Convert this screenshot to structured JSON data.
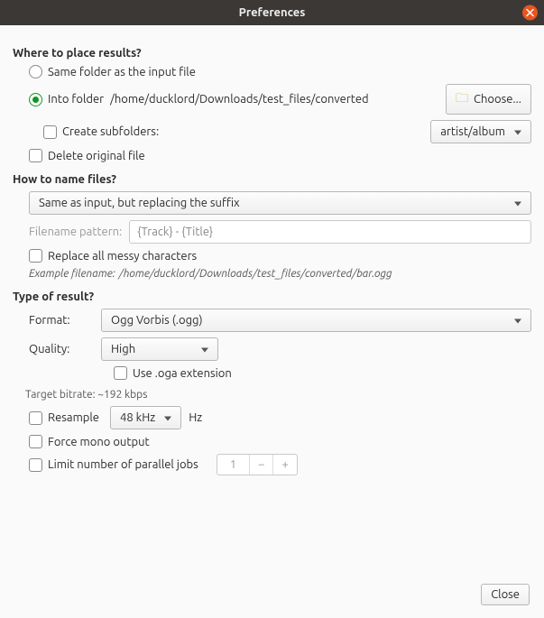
{
  "window": {
    "title": "Preferences"
  },
  "section1": {
    "heading": "Where to place results?",
    "radio_same": "Same folder as the input file",
    "radio_into": "Into folder",
    "into_path": "/home/ducklord/Downloads/test_files/converted",
    "choose_btn": "Choose...",
    "create_subfolders": "Create subfolders:",
    "subfolder_scheme": "artist/album",
    "delete_original": "Delete original file"
  },
  "section2": {
    "heading": "How to name files?",
    "naming_scheme": "Same as input, but replacing the suffix",
    "pattern_label": "Filename pattern:",
    "pattern_placeholder": "{Track} - {Title}",
    "replace_messy": "Replace all messy characters",
    "example_label": "Example filename:",
    "example_path": "/home/ducklord/Downloads/test_files/converted/bar.ogg"
  },
  "section3": {
    "heading": "Type of result?",
    "format_label": "Format:",
    "format_value": "Ogg Vorbis (.ogg)",
    "quality_label": "Quality:",
    "quality_value": "High",
    "oga_ext": "Use .oga extension",
    "target_bitrate": "Target bitrate: ~192 kbps",
    "resample": "Resample",
    "resample_rate": "48 kHz",
    "hz": "Hz",
    "mono": "Force mono output",
    "limit_jobs": "Limit number of parallel jobs",
    "jobs_value": "1"
  },
  "footer": {
    "close": "Close"
  }
}
